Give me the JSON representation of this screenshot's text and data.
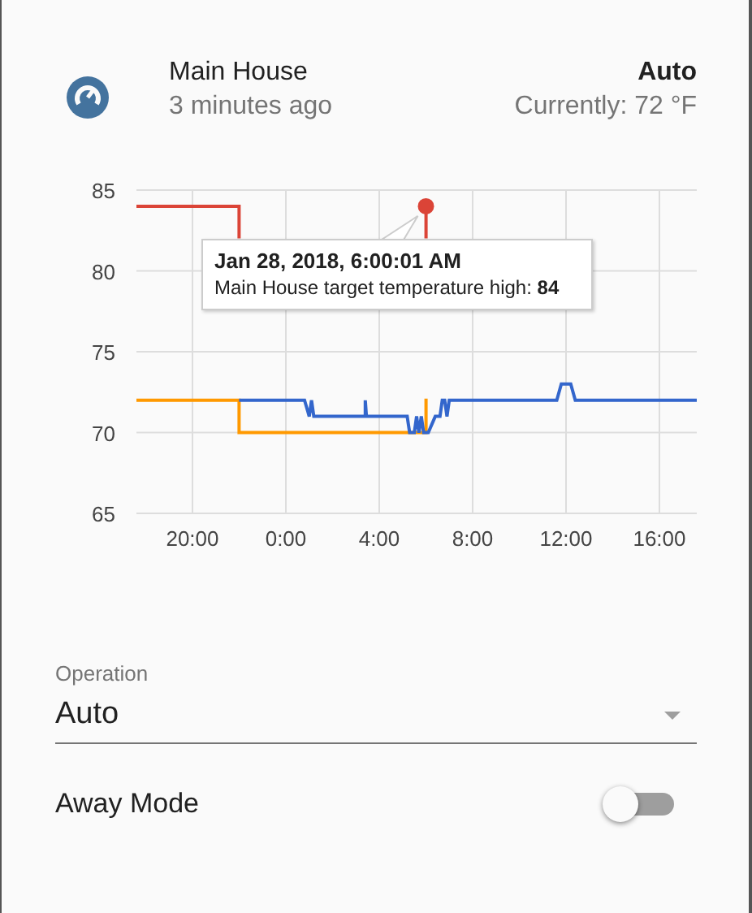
{
  "header": {
    "name": "Main House",
    "updated": "3 minutes ago",
    "mode": "Auto",
    "current": "Currently: 72 °F"
  },
  "chart": {
    "chart_data": {
      "type": "line",
      "grid": true,
      "xlim": [
        "2018-01-27T17:36",
        "2018-01-28T17:36"
      ],
      "ylim": [
        65,
        85
      ],
      "xticks": [
        {
          "value": "2018-01-27T20:00",
          "label": "20:00"
        },
        {
          "value": "2018-01-28T00:00",
          "label": "0:00"
        },
        {
          "value": "2018-01-28T04:00",
          "label": "4:00"
        },
        {
          "value": "2018-01-28T08:00",
          "label": "8:00"
        },
        {
          "value": "2018-01-28T12:00",
          "label": "12:00"
        },
        {
          "value": "2018-01-28T16:00",
          "label": "16:00"
        }
      ],
      "yticks": [
        65,
        70,
        75,
        80,
        85
      ],
      "series": [
        {
          "color": "#db4437",
          "x": [
            "2018-01-27T17:36",
            "2018-01-27T22:00",
            "2018-01-27T22:00",
            null,
            "2018-01-28T06:00",
            "2018-01-28T06:00"
          ],
          "values": [
            84,
            84,
            82,
            null,
            82,
            84
          ]
        },
        {
          "color": "#ff9900",
          "x": [
            "2018-01-27T17:36",
            "2018-01-27T22:00",
            "2018-01-27T22:00",
            "2018-01-28T06:00",
            "2018-01-28T06:00"
          ],
          "values": [
            72,
            72,
            70,
            70,
            72.1
          ]
        },
        {
          "color": "#3366cc",
          "x": [
            "2018-01-27T22:00",
            "2018-01-28T00:48",
            "2018-01-28T01:00",
            "2018-01-28T01:06",
            "2018-01-28T01:12",
            "2018-01-28T03:24",
            "2018-01-28T03:24",
            "2018-01-28T03:27",
            "2018-01-28T05:12",
            "2018-01-28T05:18",
            "2018-01-28T05:30",
            "2018-01-28T05:36",
            "2018-01-28T05:42",
            "2018-01-28T05:48",
            "2018-01-28T05:54",
            "2018-01-28T06:06",
            "2018-01-28T06:24",
            "2018-01-28T06:36",
            "2018-01-28T06:42",
            "2018-01-28T06:48",
            "2018-01-28T06:54",
            "2018-01-28T07:00",
            "2018-01-28T11:36",
            "2018-01-28T11:48",
            "2018-01-28T12:12",
            "2018-01-28T12:24",
            "2018-01-28T17:36"
          ],
          "values": [
            72,
            72,
            71,
            72,
            71,
            71,
            72,
            71,
            71,
            70,
            70,
            71,
            70,
            71,
            70,
            70,
            71,
            71,
            72,
            72,
            71,
            72,
            72,
            73,
            73,
            72,
            72
          ]
        }
      ]
    },
    "tooltip": {
      "title": "Jan 28, 2018, 6:00:01 AM",
      "text": "Main House target temperature high: **84**"
    }
  },
  "operation": {
    "label": "Operation",
    "value": "Auto"
  },
  "away_mode": {
    "label": "Away Mode",
    "on": false
  }
}
